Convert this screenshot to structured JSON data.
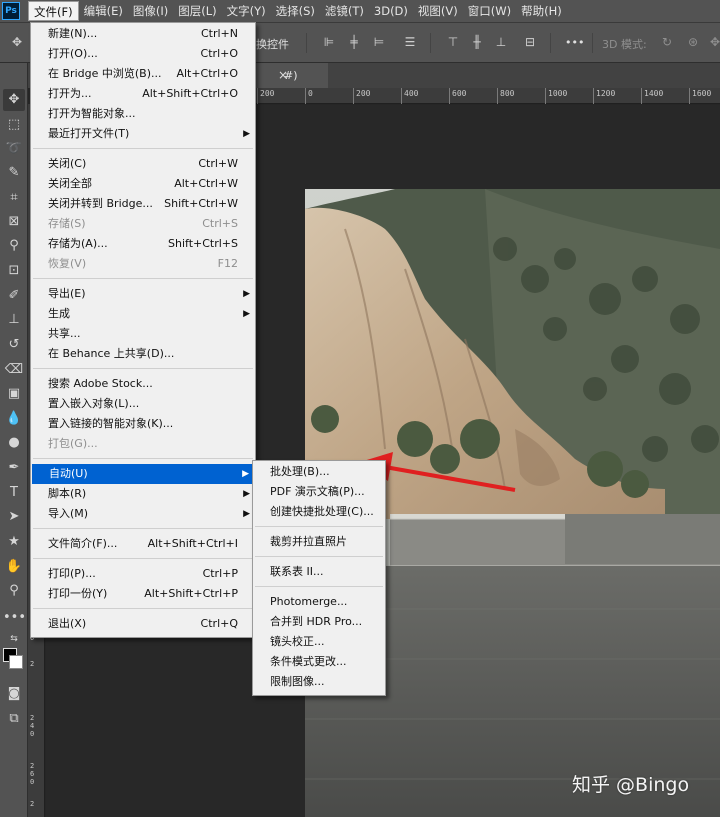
{
  "app": {
    "logo": "Ps"
  },
  "menubar": [
    "文件(F)",
    "编辑(E)",
    "图像(I)",
    "图层(L)",
    "文字(Y)",
    "选择(S)",
    "滤镜(T)",
    "3D(D)",
    "视图(V)",
    "窗口(W)",
    "帮助(H)"
  ],
  "optionsbar": {
    "transform_label": "换控件",
    "more": "•••",
    "mode_3d": "3D 模式:"
  },
  "document": {
    "tab_suffix": "#)",
    "close": "×"
  },
  "ruler": {
    "h_labels": [
      "200",
      "0",
      "200",
      "400",
      "600",
      "800",
      "1000",
      "1200",
      "1400",
      "1600"
    ],
    "v_labels": [
      "0",
      "2",
      "2",
      "4",
      "0",
      "2",
      "6",
      "0",
      "2",
      "8"
    ]
  },
  "file_menu": {
    "items": [
      {
        "label": "新建(N)...",
        "shortcut": "Ctrl+N"
      },
      {
        "label": "打开(O)...",
        "shortcut": "Ctrl+O"
      },
      {
        "label": "在 Bridge 中浏览(B)...",
        "shortcut": "Alt+Ctrl+O"
      },
      {
        "label": "打开为...",
        "shortcut": "Alt+Shift+Ctrl+O"
      },
      {
        "label": "打开为智能对象...",
        "shortcut": ""
      },
      {
        "label": "最近打开文件(T)",
        "shortcut": "",
        "submenu": true
      },
      {
        "sep": true
      },
      {
        "label": "关闭(C)",
        "shortcut": "Ctrl+W"
      },
      {
        "label": "关闭全部",
        "shortcut": "Alt+Ctrl+W"
      },
      {
        "label": "关闭并转到 Bridge...",
        "shortcut": "Shift+Ctrl+W"
      },
      {
        "label": "存储(S)",
        "shortcut": "Ctrl+S",
        "disabled": true
      },
      {
        "label": "存储为(A)...",
        "shortcut": "Shift+Ctrl+S"
      },
      {
        "label": "恢复(V)",
        "shortcut": "F12",
        "disabled": true
      },
      {
        "sep": true
      },
      {
        "label": "导出(E)",
        "shortcut": "",
        "submenu": true
      },
      {
        "label": "生成",
        "shortcut": "",
        "submenu": true
      },
      {
        "label": "共享...",
        "shortcut": ""
      },
      {
        "label": "在 Behance 上共享(D)...",
        "shortcut": ""
      },
      {
        "sep": true
      },
      {
        "label": "搜索 Adobe Stock...",
        "shortcut": ""
      },
      {
        "label": "置入嵌入对象(L)...",
        "shortcut": ""
      },
      {
        "label": "置入链接的智能对象(K)...",
        "shortcut": ""
      },
      {
        "label": "打包(G)...",
        "shortcut": "",
        "disabled": true
      },
      {
        "sep": true
      },
      {
        "label": "自动(U)",
        "shortcut": "",
        "submenu": true,
        "highlighted": true
      },
      {
        "label": "脚本(R)",
        "shortcut": "",
        "submenu": true
      },
      {
        "label": "导入(M)",
        "shortcut": "",
        "submenu": true
      },
      {
        "sep": true
      },
      {
        "label": "文件简介(F)...",
        "shortcut": "Alt+Shift+Ctrl+I"
      },
      {
        "sep": true
      },
      {
        "label": "打印(P)...",
        "shortcut": "Ctrl+P"
      },
      {
        "label": "打印一份(Y)",
        "shortcut": "Alt+Shift+Ctrl+P"
      },
      {
        "sep": true
      },
      {
        "label": "退出(X)",
        "shortcut": "Ctrl+Q"
      }
    ]
  },
  "automate_menu": {
    "items": [
      {
        "label": "批处理(B)..."
      },
      {
        "label": "PDF 演示文稿(P)..."
      },
      {
        "label": "创建快捷批处理(C)..."
      },
      {
        "sep": true
      },
      {
        "label": "裁剪并拉直照片"
      },
      {
        "sep": true
      },
      {
        "label": "联系表 II..."
      },
      {
        "sep": true
      },
      {
        "label": "Photomerge..."
      },
      {
        "label": "合并到 HDR Pro..."
      },
      {
        "label": "镜头校正..."
      },
      {
        "label": "条件模式更改..."
      },
      {
        "label": "限制图像..."
      }
    ]
  },
  "watermark": "知乎 @Bingo",
  "colors": {
    "highlight": "#0062d1",
    "arrow": "#e02020"
  }
}
